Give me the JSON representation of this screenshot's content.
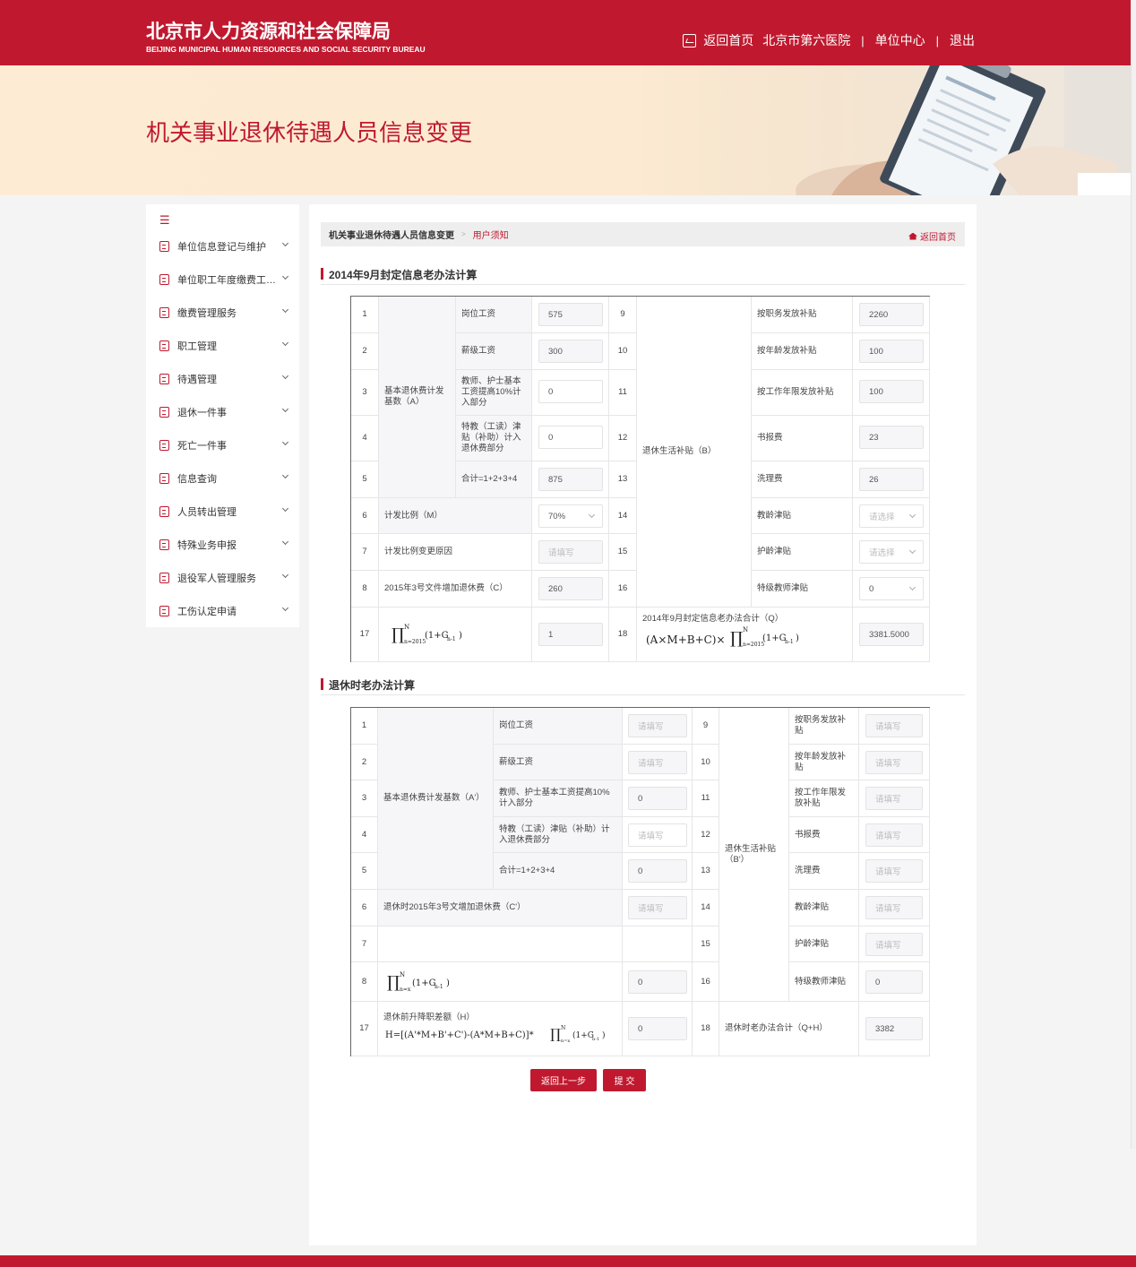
{
  "header": {
    "org_cn": "北京市人力资源和社会保障局",
    "org_en": "BEIJING MUNICIPAL HUMAN RESOURCES AND SOCIAL SECURITY BUREAU",
    "nav": {
      "home": "返回首页",
      "unit": "北京市第六医院",
      "center": "单位中心",
      "logout": "退出",
      "sep": "|"
    }
  },
  "banner": {
    "title": "机关事业退休待遇人员信息变更"
  },
  "sidebar": {
    "items": [
      {
        "label": "单位信息登记与维护"
      },
      {
        "label": "单位职工年度缴费工资申报"
      },
      {
        "label": "缴费管理服务"
      },
      {
        "label": "职工管理"
      },
      {
        "label": "待遇管理"
      },
      {
        "label": "退休一件事"
      },
      {
        "label": "死亡一件事"
      },
      {
        "label": "信息查询"
      },
      {
        "label": "人员转出管理"
      },
      {
        "label": "特殊业务申报"
      },
      {
        "label": "退役军人管理服务"
      },
      {
        "label": "工伤认定申请"
      }
    ]
  },
  "breadcrumb": {
    "parent": "机关事业退休待遇人员信息变更",
    "arrow": ">",
    "current": "用户须知",
    "back": "返回首页"
  },
  "section1": {
    "title": "2014年9月封定信息老办法计算",
    "group_a": "基本退休费计发基数（A）",
    "group_b": "退休生活补贴（B）",
    "rows_left": [
      {
        "no": "1",
        "label": "岗位工资",
        "value": "575"
      },
      {
        "no": "2",
        "label": "薪级工资",
        "value": "300"
      },
      {
        "no": "3",
        "label": "教师、护士基本工资提高10%计入部分",
        "value": "0"
      },
      {
        "no": "4",
        "label": "特教（工读）津贴（补助）计入退休费部分",
        "value": "0"
      },
      {
        "no": "5",
        "label": "合计=1+2+3+4",
        "value": "875"
      },
      {
        "no": "6",
        "label": "计发比例（M）",
        "value": "70%"
      },
      {
        "no": "7",
        "label": "计发比例变更原因",
        "value": "请填写"
      },
      {
        "no": "8",
        "label": "2015年3号文件增加退休费（C）",
        "value": "260"
      },
      {
        "no": "17",
        "value": "1"
      }
    ],
    "rows_right": [
      {
        "no": "9",
        "label": "按职务发放补贴",
        "value": "2260"
      },
      {
        "no": "10",
        "label": "按年龄发放补贴",
        "value": "100"
      },
      {
        "no": "11",
        "label": "按工作年限发放补贴",
        "value": "100"
      },
      {
        "no": "12",
        "label": "书报费",
        "value": "23"
      },
      {
        "no": "13",
        "label": "洗理费",
        "value": "26"
      },
      {
        "no": "14",
        "label": "教龄津贴",
        "value": "请选择"
      },
      {
        "no": "15",
        "label": "护龄津贴",
        "value": "请选择"
      },
      {
        "no": "16",
        "label": "特级教师津贴",
        "value": "0"
      },
      {
        "no": "18",
        "label": "2014年9月封定信息老办法合计（Q）",
        "value": "3381.5000"
      }
    ]
  },
  "section2": {
    "title": "退休时老办法计算",
    "group_a": "基本退休费计发基数（A'）",
    "group_b": "退休生活补贴（B'）",
    "rows_left": [
      {
        "no": "1",
        "label": "岗位工资",
        "value": "请填写"
      },
      {
        "no": "2",
        "label": "薪级工资",
        "value": "请填写"
      },
      {
        "no": "3",
        "label": "教师、护士基本工资提高10%计入部分",
        "value": "0"
      },
      {
        "no": "4",
        "label": "特教（工读）津贴（补助）计入退休费部分",
        "value": "请填写"
      },
      {
        "no": "5",
        "label": "合计=1+2+3+4",
        "value": "0"
      },
      {
        "no": "6",
        "label": "退休时2015年3号文增加退休费（C'）",
        "value": "请填写"
      },
      {
        "no": "7"
      },
      {
        "no": "8",
        "value": "0"
      },
      {
        "no": "17",
        "label": "退休前升降职差额（H）",
        "value": "0"
      }
    ],
    "rows_right": [
      {
        "no": "9",
        "label": "按职务发放补贴",
        "value": "请填写"
      },
      {
        "no": "10",
        "label": "按年龄发放补贴",
        "value": "请填写"
      },
      {
        "no": "11",
        "label": "按工作年限发放补贴",
        "value": "请填写"
      },
      {
        "no": "12",
        "label": "书报费",
        "value": "请填写"
      },
      {
        "no": "13",
        "label": "洗理费",
        "value": "请填写"
      },
      {
        "no": "14",
        "label": "教龄津贴",
        "value": "请填写"
      },
      {
        "no": "15",
        "label": "护龄津贴",
        "value": "请填写"
      },
      {
        "no": "16",
        "label": "特级教师津贴",
        "value": "0"
      },
      {
        "no": "18",
        "label": "退休时老办法合计（Q+H）",
        "value": "3382"
      }
    ]
  },
  "buttons": {
    "back": "返回上一步",
    "submit": "提 交"
  }
}
